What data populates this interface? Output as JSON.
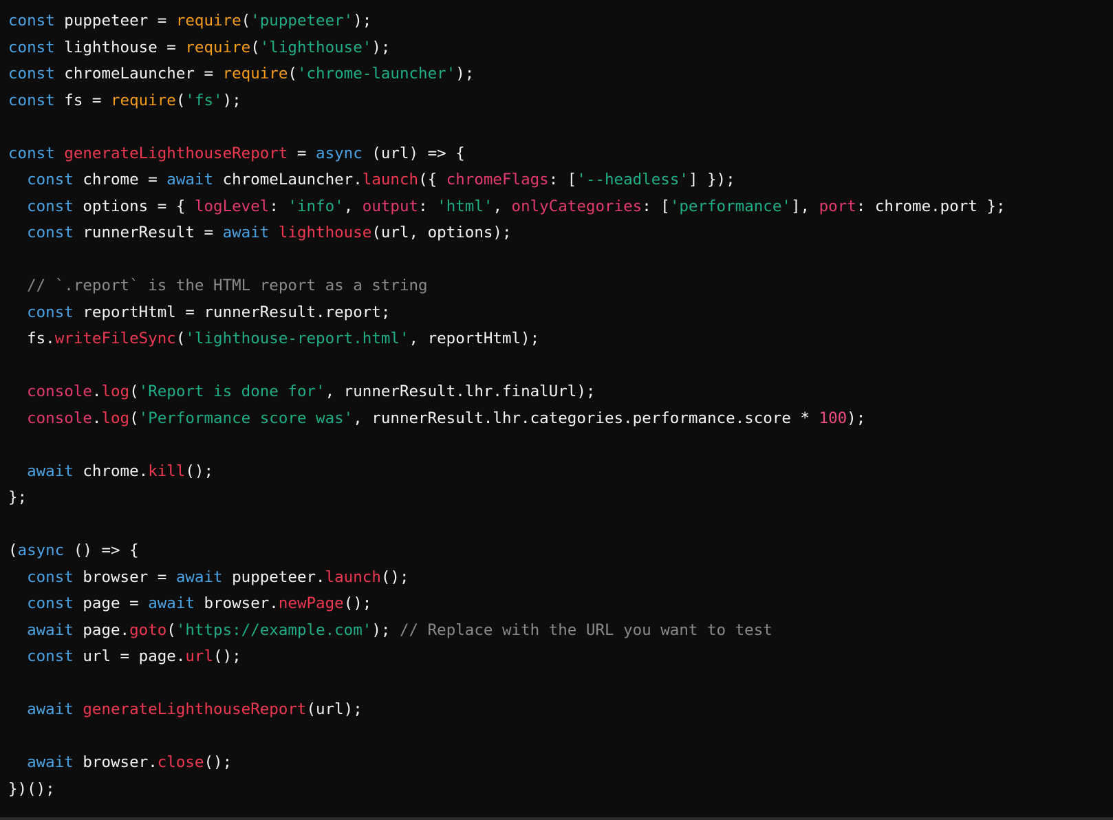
{
  "colors": {
    "background": "#0d0d0d",
    "keyword": "#4ba3e3",
    "require": "#f39c1b",
    "string": "#1fad85",
    "function_call": "#ef3852",
    "property": "#e23a6d",
    "comment": "#8a8a8a",
    "number": "#ee4a82",
    "text": "#f4f4f4"
  },
  "code": {
    "language": "javascript",
    "lines": [
      [
        {
          "k": "kw",
          "t": "const"
        },
        {
          "k": "plain",
          "t": " puppeteer = "
        },
        {
          "k": "req",
          "t": "require"
        },
        {
          "k": "plain",
          "t": "("
        },
        {
          "k": "str",
          "t": "'puppeteer'"
        },
        {
          "k": "plain",
          "t": ");"
        }
      ],
      [
        {
          "k": "kw",
          "t": "const"
        },
        {
          "k": "plain",
          "t": " lighthouse = "
        },
        {
          "k": "req",
          "t": "require"
        },
        {
          "k": "plain",
          "t": "("
        },
        {
          "k": "str",
          "t": "'lighthouse'"
        },
        {
          "k": "plain",
          "t": ");"
        }
      ],
      [
        {
          "k": "kw",
          "t": "const"
        },
        {
          "k": "plain",
          "t": " chromeLauncher = "
        },
        {
          "k": "req",
          "t": "require"
        },
        {
          "k": "plain",
          "t": "("
        },
        {
          "k": "str",
          "t": "'chrome-launcher'"
        },
        {
          "k": "plain",
          "t": ");"
        }
      ],
      [
        {
          "k": "kw",
          "t": "const"
        },
        {
          "k": "plain",
          "t": " fs = "
        },
        {
          "k": "req",
          "t": "require"
        },
        {
          "k": "plain",
          "t": "("
        },
        {
          "k": "str",
          "t": "'fs'"
        },
        {
          "k": "plain",
          "t": ");"
        }
      ],
      [],
      [
        {
          "k": "kw",
          "t": "const"
        },
        {
          "k": "plain",
          "t": " "
        },
        {
          "k": "call",
          "t": "generateLighthouseReport"
        },
        {
          "k": "plain",
          "t": " = "
        },
        {
          "k": "kw",
          "t": "async"
        },
        {
          "k": "plain",
          "t": " (url) => {"
        }
      ],
      [
        {
          "k": "plain",
          "t": "  "
        },
        {
          "k": "kw",
          "t": "const"
        },
        {
          "k": "plain",
          "t": " chrome = "
        },
        {
          "k": "kw",
          "t": "await"
        },
        {
          "k": "plain",
          "t": " chromeLauncher."
        },
        {
          "k": "call",
          "t": "launch"
        },
        {
          "k": "plain",
          "t": "({ "
        },
        {
          "k": "prop",
          "t": "chromeFlags"
        },
        {
          "k": "plain",
          "t": ": ["
        },
        {
          "k": "str",
          "t": "'--headless'"
        },
        {
          "k": "plain",
          "t": "] });"
        }
      ],
      [
        {
          "k": "plain",
          "t": "  "
        },
        {
          "k": "kw",
          "t": "const"
        },
        {
          "k": "plain",
          "t": " options = { "
        },
        {
          "k": "prop",
          "t": "logLevel"
        },
        {
          "k": "plain",
          "t": ": "
        },
        {
          "k": "str",
          "t": "'info'"
        },
        {
          "k": "plain",
          "t": ", "
        },
        {
          "k": "prop",
          "t": "output"
        },
        {
          "k": "plain",
          "t": ": "
        },
        {
          "k": "str",
          "t": "'html'"
        },
        {
          "k": "plain",
          "t": ", "
        },
        {
          "k": "prop",
          "t": "onlyCategories"
        },
        {
          "k": "plain",
          "t": ": ["
        },
        {
          "k": "str",
          "t": "'performance'"
        },
        {
          "k": "plain",
          "t": "], "
        },
        {
          "k": "prop",
          "t": "port"
        },
        {
          "k": "plain",
          "t": ": chrome.port };"
        }
      ],
      [
        {
          "k": "plain",
          "t": "  "
        },
        {
          "k": "kw",
          "t": "const"
        },
        {
          "k": "plain",
          "t": " runnerResult = "
        },
        {
          "k": "kw",
          "t": "await"
        },
        {
          "k": "plain",
          "t": " "
        },
        {
          "k": "call",
          "t": "lighthouse"
        },
        {
          "k": "plain",
          "t": "(url, options);"
        }
      ],
      [],
      [
        {
          "k": "plain",
          "t": "  "
        },
        {
          "k": "com",
          "t": "// `.report` is the HTML report as a string"
        }
      ],
      [
        {
          "k": "plain",
          "t": "  "
        },
        {
          "k": "kw",
          "t": "const"
        },
        {
          "k": "plain",
          "t": " reportHtml = runnerResult.report;"
        }
      ],
      [
        {
          "k": "plain",
          "t": "  fs."
        },
        {
          "k": "call",
          "t": "writeFileSync"
        },
        {
          "k": "plain",
          "t": "("
        },
        {
          "k": "str",
          "t": "'lighthouse-report.html'"
        },
        {
          "k": "plain",
          "t": ", reportHtml);"
        }
      ],
      [],
      [
        {
          "k": "plain",
          "t": "  "
        },
        {
          "k": "prop",
          "t": "console"
        },
        {
          "k": "plain",
          "t": "."
        },
        {
          "k": "call",
          "t": "log"
        },
        {
          "k": "plain",
          "t": "("
        },
        {
          "k": "str",
          "t": "'Report is done for'"
        },
        {
          "k": "plain",
          "t": ", runnerResult.lhr.finalUrl);"
        }
      ],
      [
        {
          "k": "plain",
          "t": "  "
        },
        {
          "k": "prop",
          "t": "console"
        },
        {
          "k": "plain",
          "t": "."
        },
        {
          "k": "call",
          "t": "log"
        },
        {
          "k": "plain",
          "t": "("
        },
        {
          "k": "str",
          "t": "'Performance score was'"
        },
        {
          "k": "plain",
          "t": ", runnerResult.lhr.categories.performance.score * "
        },
        {
          "k": "num",
          "t": "100"
        },
        {
          "k": "plain",
          "t": ");"
        }
      ],
      [],
      [
        {
          "k": "plain",
          "t": "  "
        },
        {
          "k": "kw",
          "t": "await"
        },
        {
          "k": "plain",
          "t": " chrome."
        },
        {
          "k": "call",
          "t": "kill"
        },
        {
          "k": "plain",
          "t": "();"
        }
      ],
      [
        {
          "k": "plain",
          "t": "};"
        }
      ],
      [],
      [
        {
          "k": "plain",
          "t": "("
        },
        {
          "k": "kw",
          "t": "async"
        },
        {
          "k": "plain",
          "t": " () => {"
        }
      ],
      [
        {
          "k": "plain",
          "t": "  "
        },
        {
          "k": "kw",
          "t": "const"
        },
        {
          "k": "plain",
          "t": " browser = "
        },
        {
          "k": "kw",
          "t": "await"
        },
        {
          "k": "plain",
          "t": " puppeteer."
        },
        {
          "k": "call",
          "t": "launch"
        },
        {
          "k": "plain",
          "t": "();"
        }
      ],
      [
        {
          "k": "plain",
          "t": "  "
        },
        {
          "k": "kw",
          "t": "const"
        },
        {
          "k": "plain",
          "t": " page = "
        },
        {
          "k": "kw",
          "t": "await"
        },
        {
          "k": "plain",
          "t": " browser."
        },
        {
          "k": "call",
          "t": "newPage"
        },
        {
          "k": "plain",
          "t": "();"
        }
      ],
      [
        {
          "k": "plain",
          "t": "  "
        },
        {
          "k": "kw",
          "t": "await"
        },
        {
          "k": "plain",
          "t": " page."
        },
        {
          "k": "call",
          "t": "goto"
        },
        {
          "k": "plain",
          "t": "("
        },
        {
          "k": "str",
          "t": "'https://example.com'"
        },
        {
          "k": "plain",
          "t": "); "
        },
        {
          "k": "com",
          "t": "// Replace with the URL you want to test"
        }
      ],
      [
        {
          "k": "plain",
          "t": "  "
        },
        {
          "k": "kw",
          "t": "const"
        },
        {
          "k": "plain",
          "t": " url = page."
        },
        {
          "k": "call",
          "t": "url"
        },
        {
          "k": "plain",
          "t": "();"
        }
      ],
      [],
      [
        {
          "k": "plain",
          "t": "  "
        },
        {
          "k": "kw",
          "t": "await"
        },
        {
          "k": "plain",
          "t": " "
        },
        {
          "k": "call",
          "t": "generateLighthouseReport"
        },
        {
          "k": "plain",
          "t": "(url);"
        }
      ],
      [],
      [
        {
          "k": "plain",
          "t": "  "
        },
        {
          "k": "kw",
          "t": "await"
        },
        {
          "k": "plain",
          "t": " browser."
        },
        {
          "k": "call",
          "t": "close"
        },
        {
          "k": "plain",
          "t": "();"
        }
      ],
      [
        {
          "k": "plain",
          "t": "})();"
        }
      ]
    ]
  }
}
